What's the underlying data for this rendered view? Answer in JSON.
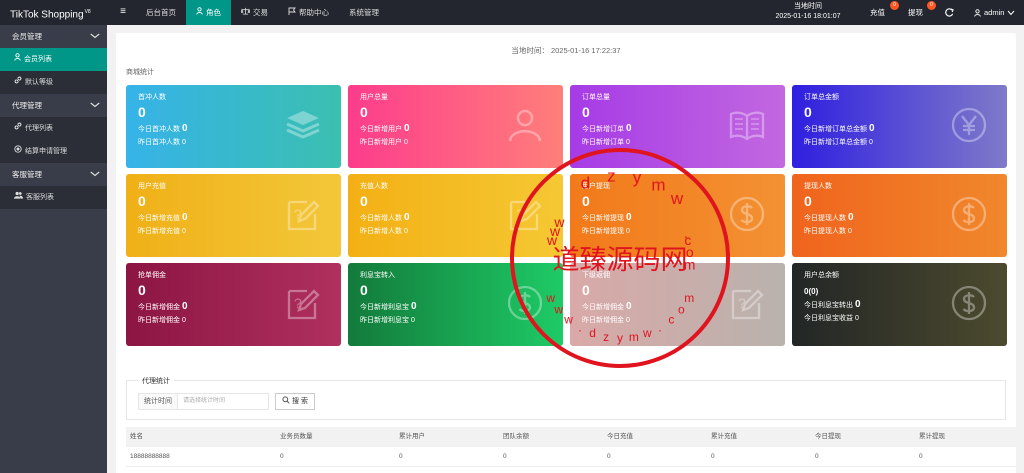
{
  "header": {
    "logo": "TikTok Shopping",
    "logo_sup": "V8",
    "menu_toggle_glyph": "≡",
    "nav": [
      {
        "label": "后台首页",
        "icon": "",
        "active": false
      },
      {
        "label": "角色",
        "icon": "user-icon",
        "active": true
      },
      {
        "label": "交易",
        "icon": "scale-icon",
        "active": false
      },
      {
        "label": "帮助中心",
        "icon": "flag-icon",
        "active": false
      },
      {
        "label": "系统管理",
        "icon": "",
        "active": false
      }
    ],
    "clock_label": "当地时间",
    "clock_value": "2025-01-16 18:01:07",
    "recharge_label": "充值",
    "recharge_badge": "0",
    "withdraw_label": "提现",
    "withdraw_badge": "0",
    "user": "admin"
  },
  "sidebar": {
    "groups": [
      {
        "label": "会员管理",
        "items": [
          {
            "label": "会员列表",
            "icon": "user-icon",
            "active": true
          },
          {
            "label": "默认等级",
            "icon": "link-icon",
            "active": false
          }
        ]
      },
      {
        "label": "代理管理",
        "items": [
          {
            "label": "代理列表",
            "icon": "link-icon",
            "active": false
          },
          {
            "label": "结算申请管理",
            "icon": "radio-icon",
            "active": false
          }
        ]
      },
      {
        "label": "客服管理",
        "items": [
          {
            "label": "客服列表",
            "icon": "users-icon",
            "active": false
          }
        ]
      }
    ]
  },
  "main": {
    "current_time": "当地时间：  2025-01-16 17:22:37",
    "section_title": "商城统计",
    "cards": [
      {
        "title": "首冲人数",
        "value": "0",
        "line1": "今日首冲人数",
        "line1_value": "0",
        "line2": "昨日首冲人数",
        "line2_value": "0",
        "icon": "layers-icon",
        "colors": [
          "#36b3e8",
          "#3bbfb0"
        ]
      },
      {
        "title": "用户总量",
        "value": "0",
        "line1": "今日新增用户",
        "line1_value": "0",
        "line2": "昨日新增用户",
        "line2_value": "0",
        "icon": "person-icon",
        "colors": [
          "#fd3c8c",
          "#ff7f7a"
        ]
      },
      {
        "title": "订单总量",
        "value": "0",
        "line1": "今日新增订单",
        "line1_value": "0",
        "line2": "昨日新增订单",
        "line2_value": "0",
        "icon": "book-icon",
        "colors": [
          "#a63be6",
          "#c268e0"
        ]
      },
      {
        "title": "订单总金额",
        "value": "0",
        "line1": "今日新增订单总金额",
        "line1_value": "0",
        "line2": "昨日新增订单总金额",
        "line2_value": "0",
        "icon": "yen-icon",
        "colors": [
          "#2f1fe0",
          "#7f7ac9"
        ]
      },
      {
        "title": "用户充值",
        "value": "0",
        "line1": "今日新增充值",
        "line1_value": "0",
        "line2": "昨日新增充值",
        "line2_value": "0",
        "icon": "edit-icon",
        "colors": [
          "#f0b017",
          "#f3c73a"
        ]
      },
      {
        "title": "充值人数",
        "value": "0",
        "line1": "今日新增人数",
        "line1_value": "0",
        "line2": "昨日新增人数",
        "line2_value": "0",
        "icon": "edit-icon",
        "colors": [
          "#f3b015",
          "#f5c833"
        ]
      },
      {
        "title": "用户提现",
        "value": "0",
        "line1": "今日新增提现",
        "line1_value": "0",
        "line2": "昨日新增提现",
        "line2_value": "0",
        "icon": "dollar-icon",
        "colors": [
          "#f27a1a",
          "#f39133"
        ]
      },
      {
        "title": "提现人数",
        "value": "0",
        "line1": "今日提现人数",
        "line1_value": "0",
        "line2": "昨日提现人数",
        "line2_value": "0",
        "icon": "dollar-icon",
        "colors": [
          "#f0641d",
          "#f0882c"
        ]
      },
      {
        "title": "抢单佣金",
        "value": "0",
        "line1": "今日新增佣金",
        "line1_value": "0",
        "line2": "昨日新增佣金",
        "line2_value": "0",
        "icon": "edit-icon",
        "colors": [
          "#8c1543",
          "#b0305e"
        ]
      },
      {
        "title": "利息宝转入",
        "value": "0",
        "line1": "今日新增利息宝",
        "line1_value": "0",
        "line2": "昨日新增利息宝",
        "line2_value": "0",
        "icon": "dollar-icon",
        "colors": [
          "#137a3b",
          "#1ecb66"
        ]
      },
      {
        "title": "下级返佣",
        "value": "0",
        "line1": "今日新增佣金",
        "line1_value": "0",
        "line2": "昨日新增佣金",
        "line2_value": "0",
        "icon": "edit-icon",
        "colors": [
          "#d9a9a8",
          "#b9b2ad"
        ]
      },
      {
        "title": "用户总余额",
        "value": "0(0)",
        "line1": "今日利息宝转出",
        "line1_value": "0",
        "line2": "今日利息宝收益",
        "line2_value": "0",
        "icon": "dollar-icon",
        "colors": [
          "#222626",
          "#4c4a2e"
        ],
        "small_value": true
      }
    ]
  },
  "agent": {
    "legend": "代理统计",
    "filter_label": "统计时间",
    "filter_placeholder": "请选择统计时间",
    "search_label": "搜 索",
    "columns": [
      "姓名",
      "业务员数量",
      "累计用户",
      "团队余额",
      "今日充值",
      "累计充值",
      "今日提现",
      "累计提现"
    ],
    "rows": [
      [
        "18888888888",
        "0",
        "0",
        "0",
        "0",
        "0",
        "0",
        "0"
      ]
    ]
  },
  "watermark": {
    "main_text": "道臻源码网",
    "ring_top": "dzymw",
    "ring_bottom": "www.dzymw.com",
    "color": "#e0141e"
  }
}
